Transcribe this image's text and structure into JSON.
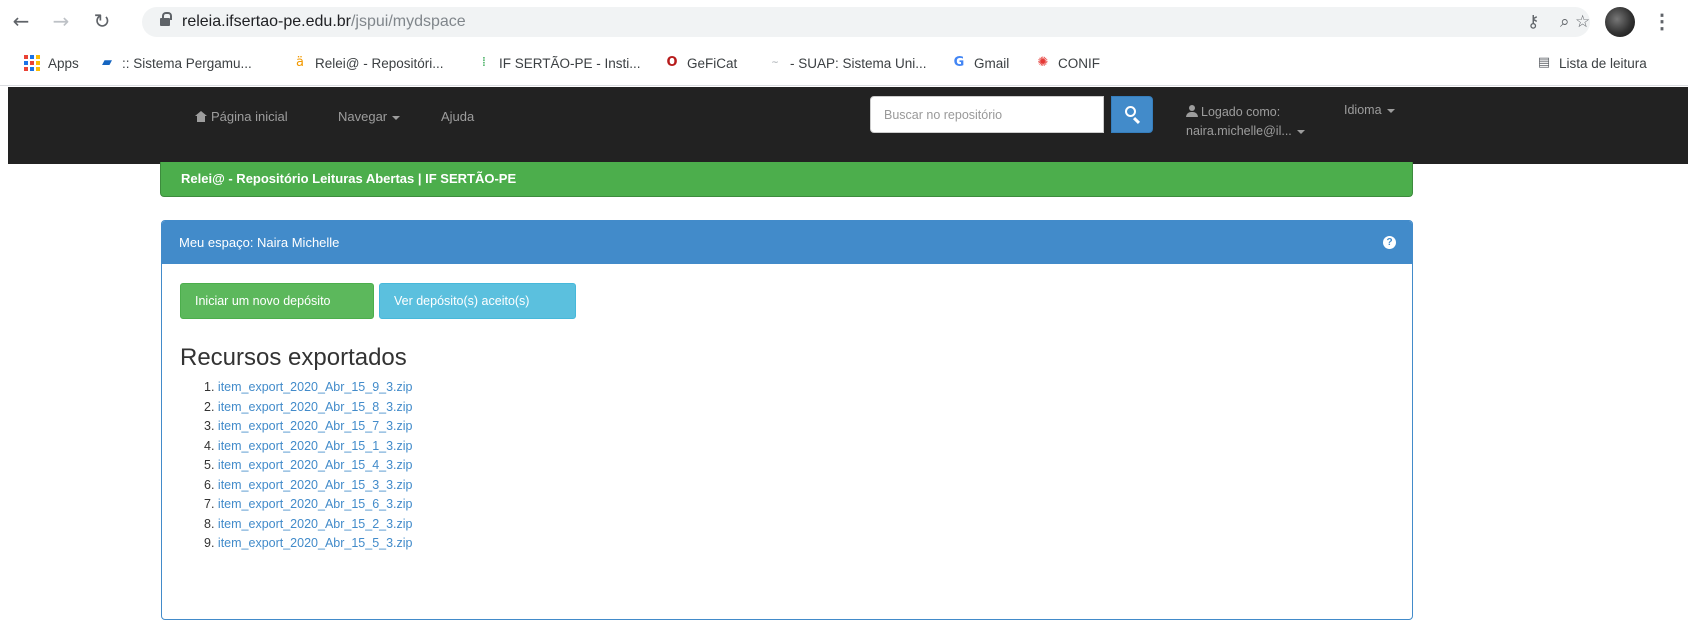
{
  "browser": {
    "url_host": "releia.ifsertao-pe.edu.br",
    "url_path": "/jspui/mydspace",
    "nav_icons": {
      "back": "arrow-left-icon",
      "forward": "arrow-right-icon",
      "reload": "reload-icon"
    },
    "bookmarks": [
      {
        "label": "Apps",
        "icon": "apps-grid-icon"
      },
      {
        "label": ":: Sistema Pergamu...",
        "icon": "pergamum-icon"
      },
      {
        "label": "Relei@ - Repositóri...",
        "icon": "releia-icon"
      },
      {
        "label": "IF SERTÃO-PE - Insti...",
        "icon": "ifsertao-icon"
      },
      {
        "label": "GeFiCat",
        "icon": "geficat-icon"
      },
      {
        "label": "- SUAP: Sistema Uni...",
        "icon": "suap-icon"
      },
      {
        "label": "Gmail",
        "icon": "google-icon"
      },
      {
        "label": "CONIF",
        "icon": "conif-icon"
      }
    ],
    "reading_list": "Lista de leitura"
  },
  "navbar": {
    "home": "Página inicial",
    "browse": "Navegar",
    "help": "Ajuda",
    "search_placeholder": "Buscar no repositório",
    "logged_label": "Logado como:",
    "logged_user": "naira.michelle@il...",
    "language": "Idioma"
  },
  "banner": "Relei@ - Repositório Leituras Abertas | IF SERTÃO-PE",
  "panel": {
    "title": "Meu espaço: Naira Michelle",
    "new_deposit": "Iniciar um novo depósito",
    "view_accepted": "Ver depósito(s) aceito(s)",
    "exports_title": "Recursos exportados",
    "exports": [
      {
        "num": "1.",
        "file": "item_export_2020_Abr_15_9_3.zip"
      },
      {
        "num": "2.",
        "file": "item_export_2020_Abr_15_8_3.zip"
      },
      {
        "num": "3.",
        "file": "item_export_2020_Abr_15_7_3.zip"
      },
      {
        "num": "4.",
        "file": "item_export_2020_Abr_15_1_3.zip"
      },
      {
        "num": "5.",
        "file": "item_export_2020_Abr_15_4_3.zip"
      },
      {
        "num": "6.",
        "file": "item_export_2020_Abr_15_3_3.zip"
      },
      {
        "num": "7.",
        "file": "item_export_2020_Abr_15_6_3.zip"
      },
      {
        "num": "8.",
        "file": "item_export_2020_Abr_15_2_3.zip"
      },
      {
        "num": "9.",
        "file": "item_export_2020_Abr_15_5_3.zip"
      }
    ]
  },
  "colors": {
    "navbar": "#222222",
    "banner": "#4cae4c",
    "panel": "#428bca",
    "btn_green": "#5cb85c",
    "btn_blue": "#5bc0de"
  }
}
